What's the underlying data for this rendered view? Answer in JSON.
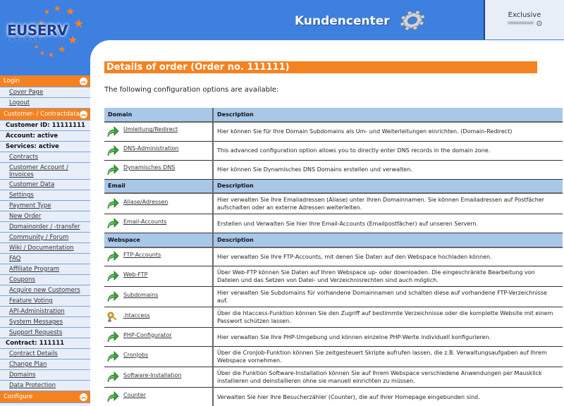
{
  "header": {
    "logo_text": "EUSERV",
    "logo_sub": "INTERNET",
    "title": "Kundencenter",
    "account_label": "Exclusive"
  },
  "colors": {
    "brand_blue": "#3d80e0",
    "accent_orange": "#f58220",
    "table_header": "#a8c8ea",
    "sidebar_bg": "#e8eef8"
  },
  "sidebar": {
    "login_header": "Login",
    "login_items": [
      "Cover Page",
      "Logout"
    ],
    "customer_header": "Customer- / Contractdata",
    "customer_id": "Customer ID: 11111111",
    "account_status": "Account: active",
    "services_status": "Services: active",
    "customer_items": [
      "Contracts",
      "Customer Account / Invoices",
      "Customer Data",
      "Settings",
      "Payment Type",
      "New Order",
      "Domainorder / -transfer",
      "Community / Forum",
      "Wiki / Documentation",
      "FAQ",
      "Affiliate Program",
      "Coupons",
      "Acquire new Customers",
      "Feature Voting",
      "API-Administration",
      "System Messages",
      "Support Requests"
    ],
    "contract_label": "Contract: 111111",
    "contract_items": [
      "Contract Details",
      "Change Plan",
      "Domains",
      "Data Protection"
    ],
    "configure_header": "Configure"
  },
  "main": {
    "page_title": "Details of order (Order no. 111111)",
    "intro": "The following configuration options are available:",
    "description_header": "Description",
    "sections": [
      {
        "name": "Domain",
        "options": [
          {
            "icon": "green-arrow-icon",
            "label": "Umleitung/Redirect",
            "description": "Hier können Sie für Ihre Domain Subdomains als Um- und Weiterleitungen einrichten. (Domain-Redirect)"
          },
          {
            "icon": "green-arrow-icon",
            "label": "DNS-Administration",
            "description": "This advanced configuration option allows you to directly enter DNS records in the domain zone."
          },
          {
            "icon": "green-arrow-icon",
            "label": "Dynamisches DNS",
            "description": "Hier können Sie Dynamisches DNS Domains erstellen und verwalten."
          }
        ]
      },
      {
        "name": "Email",
        "options": [
          {
            "icon": "green-arrow-icon",
            "label": "Aliase/Adressen",
            "description": "Hier verwalten Sie Ihre Emailadressen (Aliase) unter Ihren Domainnamen. Sie können Emailadressen auf Postfächer aufschalten oder an externe Adressen weiterleiten."
          },
          {
            "icon": "green-arrow-icon",
            "label": "Email-Accounts",
            "description": "Erstellen und Verwalten Sie hier Ihre Email-Accounts (Emailpostfächer) auf unseren Servern."
          }
        ]
      },
      {
        "name": "Webspace",
        "options": [
          {
            "icon": "green-arrow-icon",
            "label": "FTP-Accounts",
            "description": "Hier verwalten Sie Ihre FTP-Accounts, mit denen Sie Daten auf den Webspace hochladen können."
          },
          {
            "icon": "green-arrow-icon",
            "label": "Web-FTP",
            "description": "Über Web-FTP können Sie Daten auf Ihren Webspace up- oder downloaden. Die eingeschränkte Bearbeitung von Dateien und das Setzen von Datei- und Verzeichnisrechten sind auch möglich."
          },
          {
            "icon": "green-arrow-icon",
            "label": "Subdomains",
            "description": "Hier verwalten Sie Subdomains für vorhandene Domainnamen und schalten diese auf vorhandene FTP-Verzeichnisse auf."
          },
          {
            "icon": "keys-icon",
            "label": ".htaccess",
            "description": "Über die htaccess-Funktion können Sie den Zugriff auf bestimmte Verzeichnisse oder die komplette Website mit einem Passwort schützen lassen."
          },
          {
            "icon": "green-arrow-icon",
            "label": "PHP-Configurator",
            "description": "Hier verwalten Sie Ihre PHP-Umgebung und können einzelne PHP-Werte individuell konfigurieren."
          },
          {
            "icon": "green-arrow-icon",
            "label": "CronJobs",
            "description": "Über die CronJob-Funktion können Sie zeitgesteuert Skripte aufrufen lassen, die z.B. Verwaltungsaufgaben auf Ihrem Webspace vornehmen."
          },
          {
            "icon": "green-arrow-icon",
            "label": "Software-Installation",
            "description": "Über die Funktion Software-Installation können Sie auf Ihrem Webspace verschiedene Anwendungen per Mausklick installieren und deinstallieren ohne sie manuell einrichten zu müssen."
          },
          {
            "icon": "green-arrow-icon",
            "label": "Counter",
            "description": "Verwalten Sie hier Ihre Besucherzähler (Counter), die auf Ihrer Homepage eingebunden sind."
          }
        ]
      }
    ]
  }
}
